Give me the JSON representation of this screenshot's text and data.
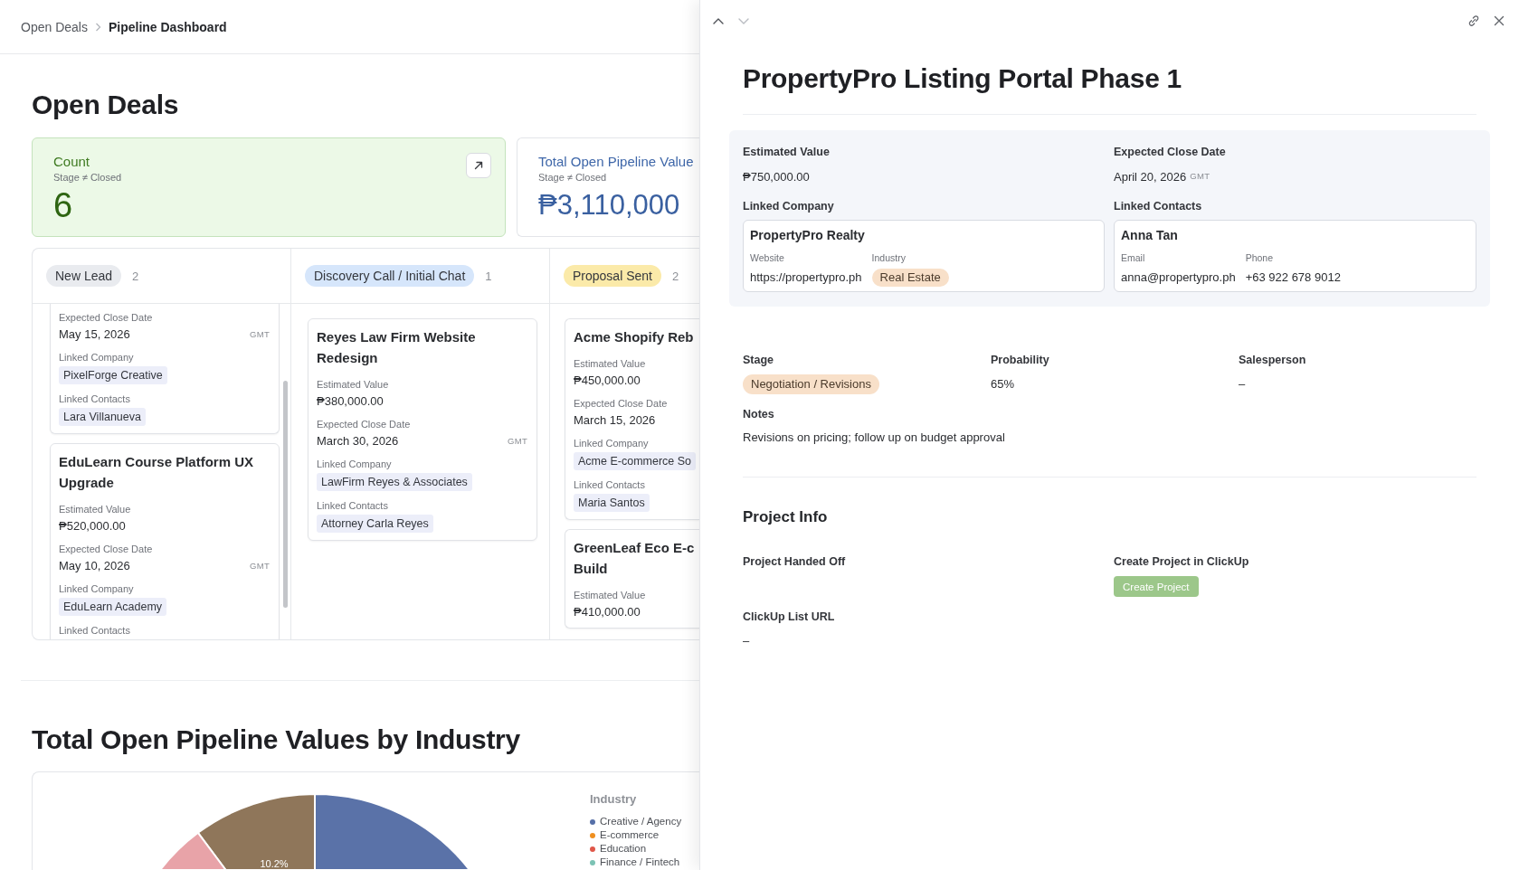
{
  "breadcrumb": [
    {
      "label": "Open Deals",
      "current": false
    },
    {
      "label": "Pipeline Dashboard",
      "current": true
    }
  ],
  "page_title": "Open Deals",
  "stat_cards": [
    {
      "kind": "count",
      "title": "Count",
      "filter": "Stage ≠ Closed",
      "value": "6",
      "expand_button": true
    },
    {
      "kind": "total",
      "title": "Total Open Pipeline Value",
      "filter": "Stage ≠ Closed",
      "value": "₱3,110,000",
      "expand_button": false
    }
  ],
  "board": {
    "columns": [
      {
        "stage": "New Lead",
        "count": "2",
        "color": "#e9ebef",
        "scrollbar": true,
        "cards": [
          {
            "fields": [
              {
                "label": "Expected Close Date",
                "value": "May 15, 2026",
                "tz": "GMT",
                "kind": "text"
              },
              {
                "label": "Linked Company",
                "value": "PixelForge Creative",
                "kind": "chip"
              },
              {
                "label": "Linked Contacts",
                "value": "Lara Villanueva",
                "kind": "chip"
              }
            ]
          },
          {
            "title": "EduLearn Course Platform UX Upgrade",
            "fields": [
              {
                "label": "Estimated Value",
                "value": "₱520,000.00",
                "kind": "text"
              },
              {
                "label": "Expected Close Date",
                "value": "May 10, 2026",
                "tz": "GMT",
                "kind": "text"
              },
              {
                "label": "Linked Company",
                "value": "EduLearn Academy",
                "kind": "chip"
              },
              {
                "label": "Linked Contacts"
              }
            ]
          }
        ]
      },
      {
        "stage": "Discovery Call / Initial Chat",
        "count": "1",
        "color": "#d6e6fb",
        "cards": [
          {
            "title": "Reyes Law Firm Website Redesign",
            "fields": [
              {
                "label": "Estimated Value",
                "value": "₱380,000.00",
                "kind": "text"
              },
              {
                "label": "Expected Close Date",
                "value": "March 30, 2026",
                "tz": "GMT",
                "kind": "text"
              },
              {
                "label": "Linked Company",
                "value": "LawFirm Reyes & Associates",
                "kind": "chip"
              },
              {
                "label": "Linked Contacts",
                "value": "Attorney Carla Reyes",
                "kind": "chip"
              }
            ]
          }
        ]
      },
      {
        "stage": "Proposal Sent",
        "count": "2",
        "color": "#fbeaa9",
        "cards": [
          {
            "title": "Acme Shopify Reb",
            "fields": [
              {
                "label": "Estimated Value",
                "value": "₱450,000.00",
                "kind": "text"
              },
              {
                "label": "Expected Close Date",
                "value": "March 15, 2026",
                "kind": "text"
              },
              {
                "label": "Linked Company",
                "value": "Acme E-commerce So",
                "kind": "chip"
              },
              {
                "label": "Linked Contacts",
                "value": "Maria Santos",
                "kind": "chip"
              }
            ]
          },
          {
            "title": "GreenLeaf Eco E-c Build",
            "fields": [
              {
                "label": "Estimated Value",
                "value": "₱410,000.00",
                "kind": "text"
              }
            ]
          }
        ]
      }
    ]
  },
  "chart_section": {
    "title": "Total Open Pipeline Values by Industry",
    "slice_label": "10.2%",
    "legend_title": "Industry",
    "legend": [
      {
        "label": "Creative / Agency",
        "color": "#5670a8"
      },
      {
        "label": "E-commerce",
        "color": "#ef8f1f"
      },
      {
        "label": "Education",
        "color": "#e05749"
      },
      {
        "label": "Finance / Fintech",
        "color": "#7cc2b4"
      }
    ]
  },
  "detail_panel": {
    "nav": [
      {
        "kind": "up",
        "disabled": false
      },
      {
        "kind": "down",
        "disabled": true
      }
    ],
    "title": "PropertyPro Listing Portal Phase 1",
    "summary": [
      {
        "label": "Estimated Value",
        "kind": "text",
        "value": "₱750,000.00"
      },
      {
        "label": "Expected Close Date",
        "kind": "text",
        "value": "April 20, 2026",
        "tz": "GMT"
      },
      {
        "label": "Linked Company",
        "kind": "record",
        "name": "PropertyPro Realty",
        "fields": [
          {
            "label": "Website",
            "value": "https://propertypro.ph",
            "kind": "text"
          },
          {
            "label": "Industry",
            "value": "Real Estate",
            "kind": "tag"
          }
        ]
      },
      {
        "label": "Linked Contacts",
        "kind": "record",
        "name": "Anna Tan",
        "fields": [
          {
            "label": "Email",
            "value": "anna@propertypro.ph",
            "kind": "text"
          },
          {
            "label": "Phone",
            "value": "+63 922 678 9012",
            "kind": "text"
          }
        ]
      }
    ],
    "details": [
      {
        "label": "Stage",
        "value": "Negotiation / Revisions",
        "kind": "tag"
      },
      {
        "label": "Probability",
        "value": "65%",
        "kind": "text"
      },
      {
        "label": "Salesperson",
        "value": "–",
        "kind": "text"
      }
    ],
    "notes": {
      "label": "Notes",
      "value": "Revisions on pricing; follow up on budget approval"
    },
    "project_info": {
      "title": "Project Info",
      "fields": [
        {
          "label": "Project Handed Off",
          "kind": "text"
        },
        {
          "label": "Create Project in ClickUp",
          "kind": "button",
          "value": "Create Project"
        },
        {
          "label": "ClickUp List URL",
          "kind": "text",
          "value": "–"
        }
      ]
    }
  }
}
